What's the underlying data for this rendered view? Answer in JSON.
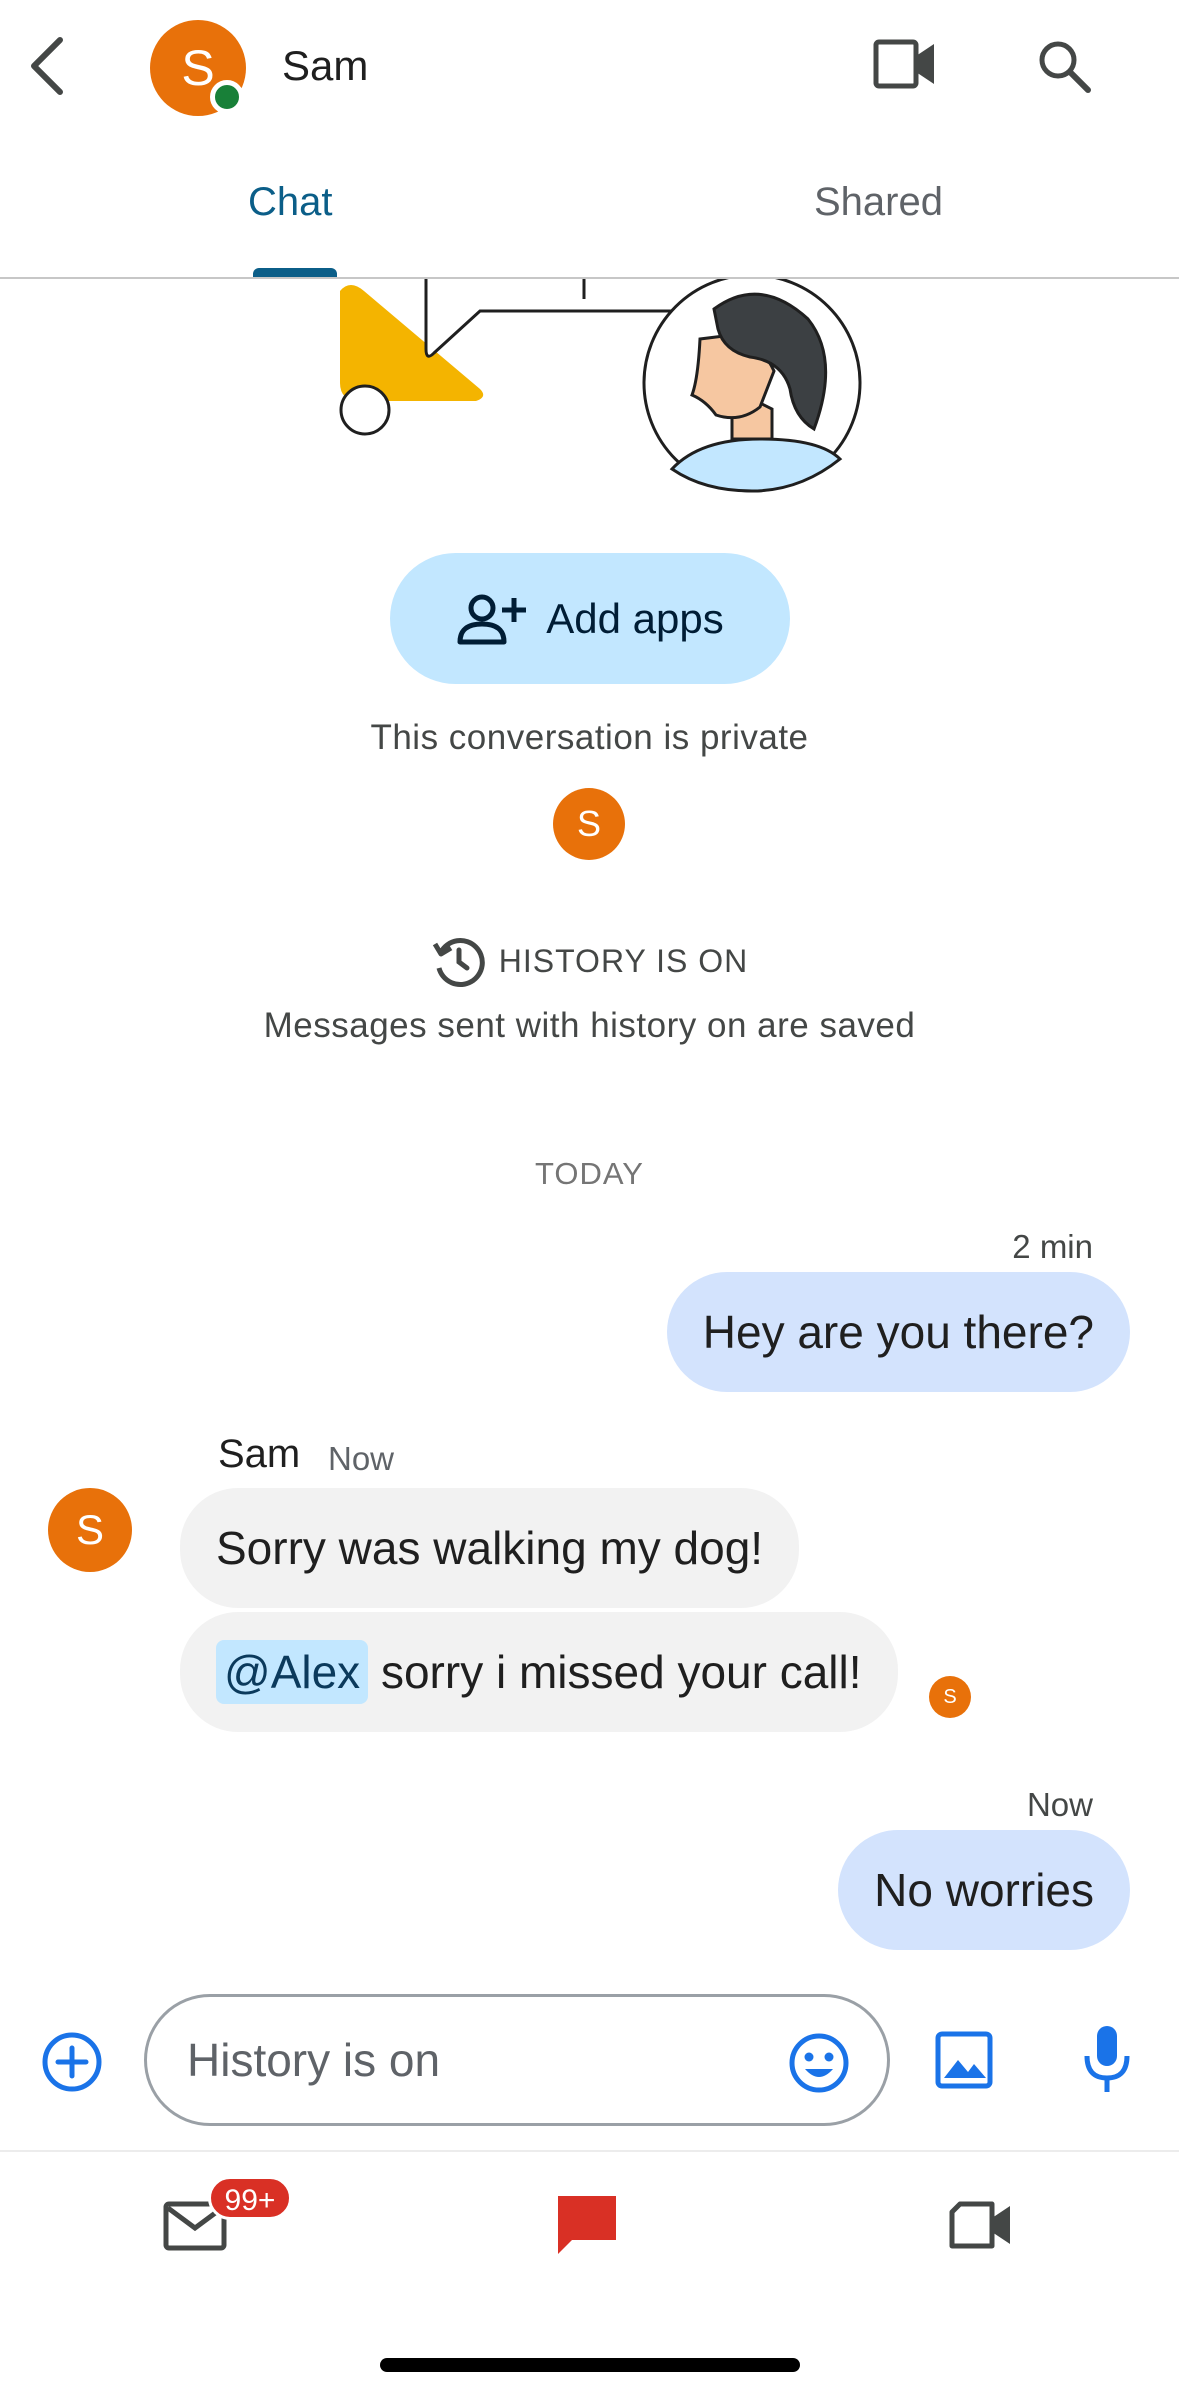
{
  "header": {
    "contact_name": "Sam",
    "avatar_letter": "S",
    "presence": "online",
    "icons": [
      "back-icon",
      "video-call-icon",
      "search-icon"
    ]
  },
  "tabs": [
    {
      "label": "Chat",
      "active": true
    },
    {
      "label": "Shared",
      "active": false
    }
  ],
  "intro": {
    "add_apps_label": "Add apps",
    "privacy_text": "This conversation is private",
    "participant_letter": "S"
  },
  "history": {
    "status": "HISTORY IS ON",
    "description": "Messages sent with history on are saved"
  },
  "date_divider": "TODAY",
  "messages": [
    {
      "direction": "out",
      "time": "2 min",
      "text": "Hey are you there?"
    },
    {
      "direction": "in",
      "sender": "Sam",
      "time": "Now",
      "avatar_letter": "S",
      "text": "Sorry was walking my dog!"
    },
    {
      "direction": "in",
      "mention": "@Alex",
      "text": "sorry i missed your call!",
      "read_by_letter": "S"
    },
    {
      "direction": "out",
      "time": "Now",
      "text": "No worries"
    }
  ],
  "composer": {
    "placeholder": "History is on",
    "icons": [
      "add-icon",
      "emoji-icon",
      "image-icon",
      "mic-icon"
    ]
  },
  "bottom_nav": {
    "mail_badge": "99+",
    "items": [
      "mail",
      "chat",
      "meet"
    ]
  },
  "colors": {
    "accent": "#0b5e88",
    "avatar": "#e8710a",
    "presence": "#188038",
    "outgoing_bubble": "#d3e3fd",
    "incoming_bubble": "#f2f2f2",
    "add_apps_bg": "#c2e7ff",
    "badge": "#d93025",
    "composer_icons": "#1a73e8"
  }
}
